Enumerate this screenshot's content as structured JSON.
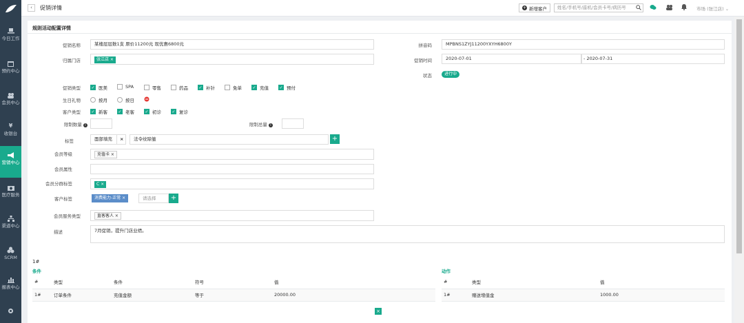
{
  "sidebar": {
    "items": [
      {
        "label": "今日工作",
        "icon": "laptop-icon"
      },
      {
        "label": "预约中心",
        "icon": "calendar-icon"
      },
      {
        "label": "会员中心",
        "icon": "users-icon"
      },
      {
        "label": "收银台",
        "icon": "yen-icon"
      },
      {
        "label": "营销中心",
        "icon": "megaphone-icon"
      },
      {
        "label": "医疗服务",
        "icon": "medkit-icon"
      },
      {
        "label": "渠道中心",
        "icon": "sitemap-icon"
      },
      {
        "label": "SCRM",
        "icon": "cubes-icon"
      },
      {
        "label": "报表中心",
        "icon": "bar-chart-icon"
      },
      {
        "label": "",
        "icon": "gear-icon"
      }
    ]
  },
  "header": {
    "back": "‹",
    "title": "促销详情",
    "new_customer": "新增客户",
    "search_placeholder": "姓名/手机号/座机/会员卡号/病历号",
    "region": "市场 (张江店) ⌄"
  },
  "panel": {
    "title": "规则活动配置详情",
    "fields": {
      "promo_name_label": "促销名称",
      "promo_name": "某楼层层数1支  原价11200元  现优惠6800元",
      "pinyin_label": "拼音码",
      "pinyin": "MPBNS1ZYJ11200YXYH6800Y",
      "store_label": "归属门店",
      "store_tag": "张江店 ×",
      "time_label": "促销时间",
      "time_start": "2020-07-01",
      "time_sep": "-",
      "time_end": "2020-07-31",
      "status_label": "状态",
      "status": "进行中",
      "promo_type_label": "促销类型",
      "promo_types": [
        {
          "label": "医美",
          "checked": true
        },
        {
          "label": "SPA",
          "checked": false
        },
        {
          "label": "零售",
          "checked": false
        },
        {
          "label": "药品",
          "checked": false
        },
        {
          "label": "补针",
          "checked": true
        },
        {
          "label": "免单",
          "checked": false
        },
        {
          "label": "充值",
          "checked": true
        },
        {
          "label": "预付",
          "checked": true
        }
      ],
      "birthday_label": "生日礼物",
      "birthday_opts": [
        "按月",
        "按日"
      ],
      "cust_type_label": "客户类型",
      "cust_types": [
        {
          "label": "新客",
          "checked": true
        },
        {
          "label": "老客",
          "checked": true
        },
        {
          "label": "初诊",
          "checked": true
        },
        {
          "label": "复诊",
          "checked": true
        }
      ],
      "limit_qty_label": "限制数量",
      "limit_total_label": "限制总量",
      "tags_label": "标签",
      "tag_1": "面部填充",
      "tag_x": "×",
      "tag_2": "法令纹除皱",
      "member_level_label": "会员等级",
      "member_level": "充值卡 ×",
      "member_prop_label": "会员属性",
      "member_group_label": "会员分群标签",
      "member_group": "C ×",
      "cust_tag_label": "客户标签",
      "cust_tag": "消费能力-正常  ×",
      "cust_tag_placeholder": "请选择",
      "member_service_label": "会员服务类型",
      "member_service": "直客客人 ×",
      "desc_label": "描述",
      "desc": "7月促销，提升门店业绩。"
    },
    "rule_no": "1#",
    "condition_label": "条件",
    "action_label": "动作",
    "cond_headers": [
      "#",
      "类型",
      "条件",
      "符号",
      "值"
    ],
    "cond_rows": [
      [
        "1#",
        "订单条件",
        "充值金额",
        "等于",
        "20000.00"
      ]
    ],
    "action_headers": [
      "#",
      "类型",
      "值"
    ],
    "action_rows": [
      [
        "1#",
        "赠送增值金",
        "1000.00"
      ]
    ]
  },
  "colors": {
    "accent": "#19aa8d",
    "sidebar": "#2f4050",
    "tag_blue": "#5b8dc9"
  }
}
